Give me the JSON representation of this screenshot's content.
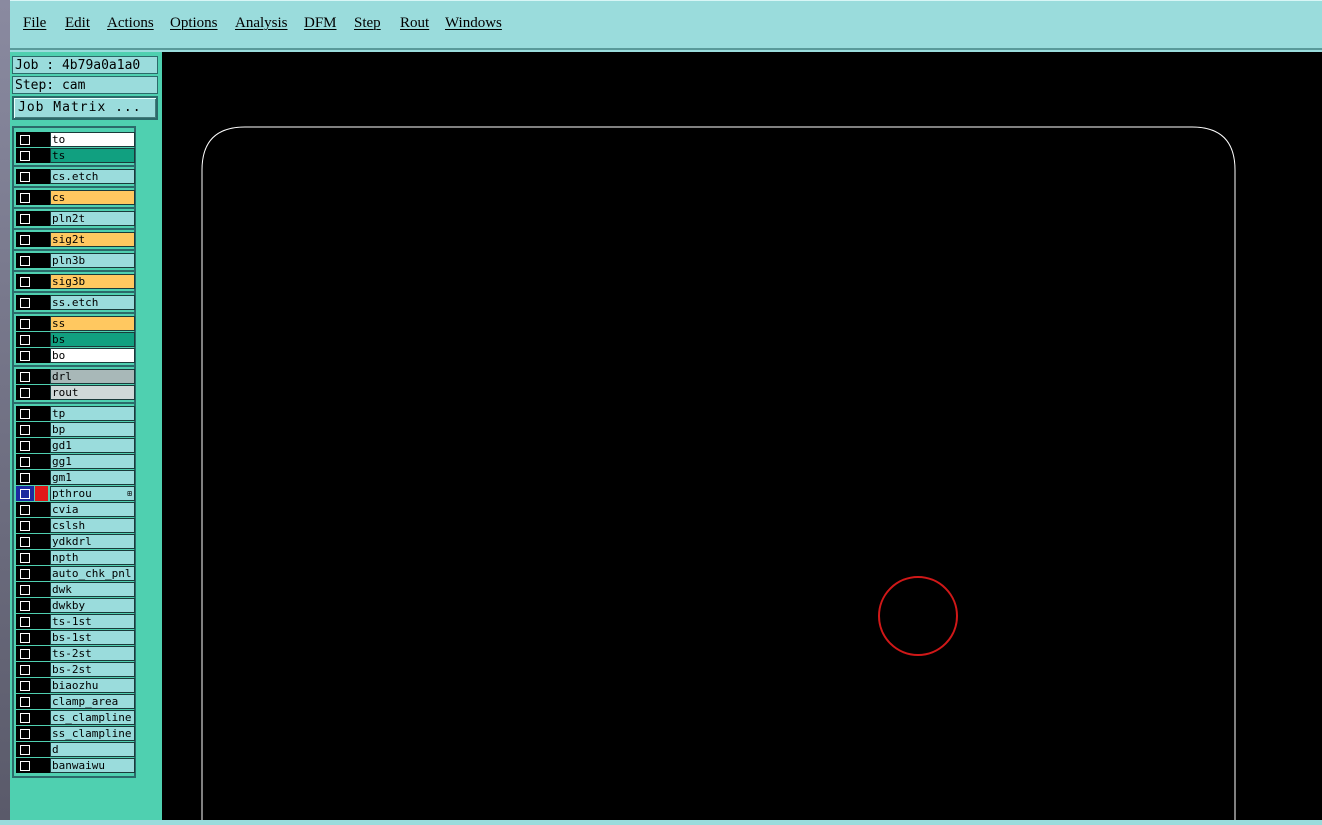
{
  "menubar": {
    "items": [
      "File",
      "Edit",
      "Actions",
      "Options",
      "Analysis",
      "DFM",
      "Step",
      "Rout",
      "Windows"
    ]
  },
  "job": {
    "label": "Job : 4b79a0a1a0",
    "step": "Step: cam",
    "matrix_button": "Job Matrix ..."
  },
  "layers": [
    {
      "name": "to",
      "color": "#ffffff"
    },
    {
      "name": "ts",
      "color": "#11a080"
    },
    {
      "name": "cs.etch",
      "color": "#9adcdc"
    },
    {
      "name": "cs",
      "color": "#ffc860"
    },
    {
      "name": "pln2t",
      "color": "#9adcdc"
    },
    {
      "name": "sig2t",
      "color": "#ffc860"
    },
    {
      "name": "pln3b",
      "color": "#9adcdc"
    },
    {
      "name": "sig3b",
      "color": "#ffc860"
    },
    {
      "name": "ss.etch",
      "color": "#9adcdc"
    },
    {
      "name": "ss",
      "color": "#ffc860"
    },
    {
      "name": "bs",
      "color": "#11a080"
    },
    {
      "name": "bo",
      "color": "#ffffff"
    },
    {
      "name": "drl",
      "color": "#a8b8b8"
    },
    {
      "name": "rout",
      "color": "#cfd8d8"
    },
    {
      "name": "tp",
      "color": "#9adcdc"
    },
    {
      "name": "bp",
      "color": "#9adcdc"
    },
    {
      "name": "gd1",
      "color": "#9adcdc"
    },
    {
      "name": "gg1",
      "color": "#9adcdc"
    },
    {
      "name": "gm1",
      "color": "#9adcdc"
    },
    {
      "name": "pthrou",
      "color": "#9adcdc",
      "selected": true,
      "indicator": "#e01818"
    },
    {
      "name": "cvia",
      "color": "#9adcdc"
    },
    {
      "name": "cslsh",
      "color": "#9adcdc"
    },
    {
      "name": "ydkdrl",
      "color": "#9adcdc"
    },
    {
      "name": "npth",
      "color": "#9adcdc"
    },
    {
      "name": "auto_chk_pnl",
      "color": "#9adcdc"
    },
    {
      "name": "dwk",
      "color": "#9adcdc"
    },
    {
      "name": "dwkby",
      "color": "#9adcdc"
    },
    {
      "name": "ts-1st",
      "color": "#9adcdc"
    },
    {
      "name": "bs-1st",
      "color": "#9adcdc"
    },
    {
      "name": "ts-2st",
      "color": "#9adcdc"
    },
    {
      "name": "bs-2st",
      "color": "#9adcdc"
    },
    {
      "name": "biaozhu",
      "color": "#9adcdc"
    },
    {
      "name": "clamp_area",
      "color": "#9adcdc"
    },
    {
      "name": "cs_clampline",
      "color": "#9adcdc"
    },
    {
      "name": "ss_clampline",
      "color": "#9adcdc"
    },
    {
      "name": "d",
      "color": "#9adcdc"
    },
    {
      "name": "banwaiwu",
      "color": "#9adcdc"
    }
  ],
  "colors": {
    "canvas_bg": "#000000",
    "board_outline": "#ffffff",
    "circle": "#d01818"
  }
}
